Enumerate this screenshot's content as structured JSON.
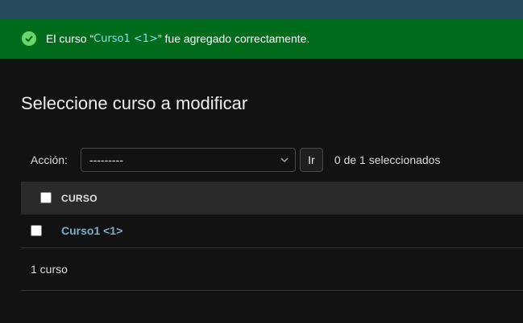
{
  "messages": {
    "success_prefix": "El curso “",
    "success_object": "Curso1 <1>",
    "success_suffix": "” fue agregado correctamente.",
    "icon": "check-circle-icon",
    "bar_color": "#006b1b"
  },
  "page": {
    "title": "Seleccione curso a modificar"
  },
  "actions": {
    "label": "Acción:",
    "selected_value": "---------",
    "go_label": "Ir",
    "selection_count": "0 de 1 seleccionados"
  },
  "table": {
    "columns": [
      "CURSO"
    ],
    "rows": [
      {
        "curso": "Curso1 <1>"
      }
    ]
  },
  "paginator": {
    "text": "1 curso"
  },
  "colors": {
    "header": "#264b5d",
    "background": "#121212",
    "link": "#79aec8"
  }
}
